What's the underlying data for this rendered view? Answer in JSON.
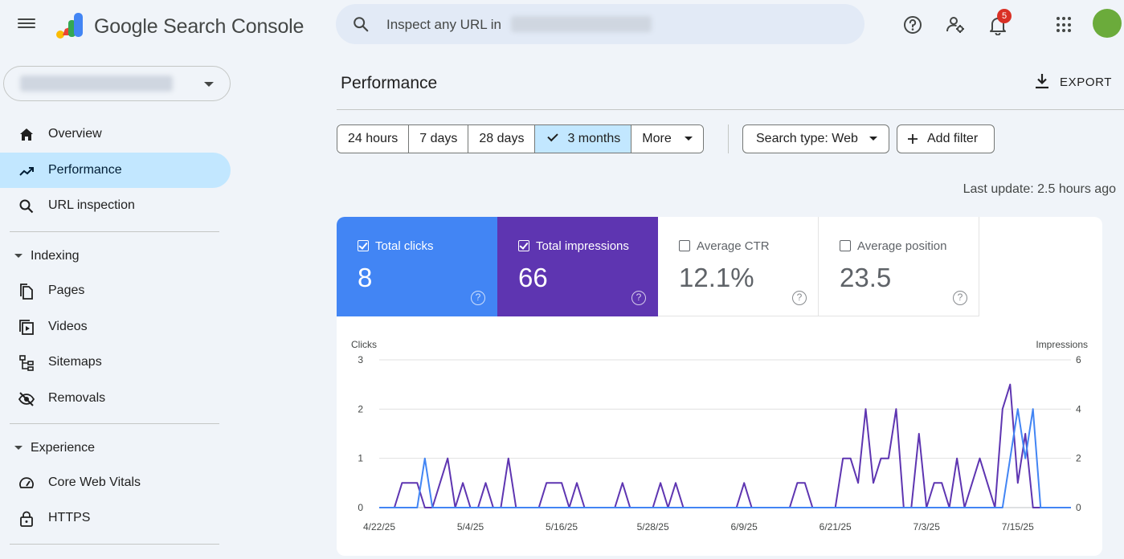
{
  "header": {
    "app_title": "Google Search Console",
    "search_placeholder": "Inspect any URL in",
    "notification_count": "5",
    "icons": [
      "menu-icon",
      "help-icon",
      "account-settings-icon",
      "notifications-icon",
      "apps-icon"
    ]
  },
  "sidebar": {
    "items": [
      {
        "label": "Overview",
        "icon": "home-icon",
        "active": false
      },
      {
        "label": "Performance",
        "icon": "trending-icon",
        "active": true
      },
      {
        "label": "URL inspection",
        "icon": "search-icon",
        "active": false
      }
    ],
    "sections": [
      {
        "label": "Indexing",
        "items": [
          {
            "label": "Pages",
            "icon": "pages-icon"
          },
          {
            "label": "Videos",
            "icon": "videos-icon"
          },
          {
            "label": "Sitemaps",
            "icon": "sitemaps-icon"
          },
          {
            "label": "Removals",
            "icon": "removals-icon"
          }
        ]
      },
      {
        "label": "Experience",
        "items": [
          {
            "label": "Core Web Vitals",
            "icon": "speed-icon"
          },
          {
            "label": "HTTPS",
            "icon": "lock-icon"
          }
        ]
      }
    ]
  },
  "main": {
    "title": "Performance",
    "export_label": "EXPORT",
    "date_ranges": [
      "24 hours",
      "7 days",
      "28 days",
      "3 months",
      "More"
    ],
    "selected_range": "3 months",
    "search_type": "Search type: Web",
    "add_filter": "Add filter",
    "last_update": "Last update: 2.5 hours ago"
  },
  "metrics": [
    {
      "label": "Total clicks",
      "value": "8",
      "checked": true,
      "color": "#4285f4"
    },
    {
      "label": "Total impressions",
      "value": "66",
      "checked": true,
      "color": "#5e35b1"
    },
    {
      "label": "Average CTR",
      "value": "12.1%",
      "checked": false
    },
    {
      "label": "Average position",
      "value": "23.5",
      "checked": false
    }
  ],
  "chart_data": {
    "type": "line",
    "left_axis_label": "Clicks",
    "right_axis_label": "Impressions",
    "left_ticks": [
      "3",
      "2",
      "1",
      "0"
    ],
    "right_ticks": [
      "6",
      "4",
      "2",
      "0"
    ],
    "ylim_left": [
      0,
      3
    ],
    "ylim_right": [
      0,
      6
    ],
    "x_tick_labels": [
      "4/22/25",
      "5/4/25",
      "5/16/25",
      "5/28/25",
      "6/9/25",
      "6/21/25",
      "7/3/25",
      "7/15/25"
    ],
    "x_tick_index": [
      0,
      12,
      24,
      36,
      48,
      60,
      72,
      84
    ],
    "series": [
      {
        "name": "Clicks",
        "color": "#4285f4",
        "axis": "left",
        "values": [
          0,
          0,
          0,
          0,
          0,
          0,
          1,
          0,
          0,
          0,
          0,
          0,
          0,
          0,
          0,
          0,
          0,
          0,
          0,
          0,
          0,
          0,
          0,
          0,
          0,
          0,
          0,
          0,
          0,
          0,
          0,
          0,
          0,
          0,
          0,
          0,
          0,
          0,
          0,
          0,
          0,
          0,
          0,
          0,
          0,
          0,
          0,
          0,
          0,
          0,
          0,
          0,
          0,
          0,
          0,
          0,
          0,
          0,
          0,
          0,
          0,
          0,
          0,
          0,
          0,
          0,
          0,
          0,
          0,
          0,
          0,
          0,
          0,
          0,
          0,
          0,
          0,
          0,
          0,
          0,
          0,
          0,
          0,
          1,
          2,
          1,
          2,
          0,
          0,
          0,
          0,
          0
        ]
      },
      {
        "name": "Impressions",
        "color": "#5e35b1",
        "axis": "right",
        "values": [
          0,
          0,
          0,
          1,
          1,
          1,
          0,
          0,
          1,
          2,
          0,
          1,
          0,
          0,
          1,
          0,
          0,
          2,
          0,
          0,
          0,
          0,
          1,
          1,
          1,
          0,
          1,
          0,
          0,
          0,
          0,
          0,
          1,
          0,
          0,
          0,
          0,
          1,
          0,
          1,
          0,
          0,
          0,
          0,
          0,
          0,
          0,
          0,
          1,
          0,
          0,
          0,
          0,
          0,
          0,
          1,
          1,
          0,
          0,
          0,
          0,
          2,
          2,
          1,
          4,
          1,
          2,
          2,
          4,
          0,
          0,
          3,
          0,
          1,
          1,
          0,
          2,
          0,
          1,
          2,
          1,
          0,
          4,
          5,
          1,
          3,
          0,
          0,
          0,
          0,
          0
        ]
      }
    ]
  }
}
